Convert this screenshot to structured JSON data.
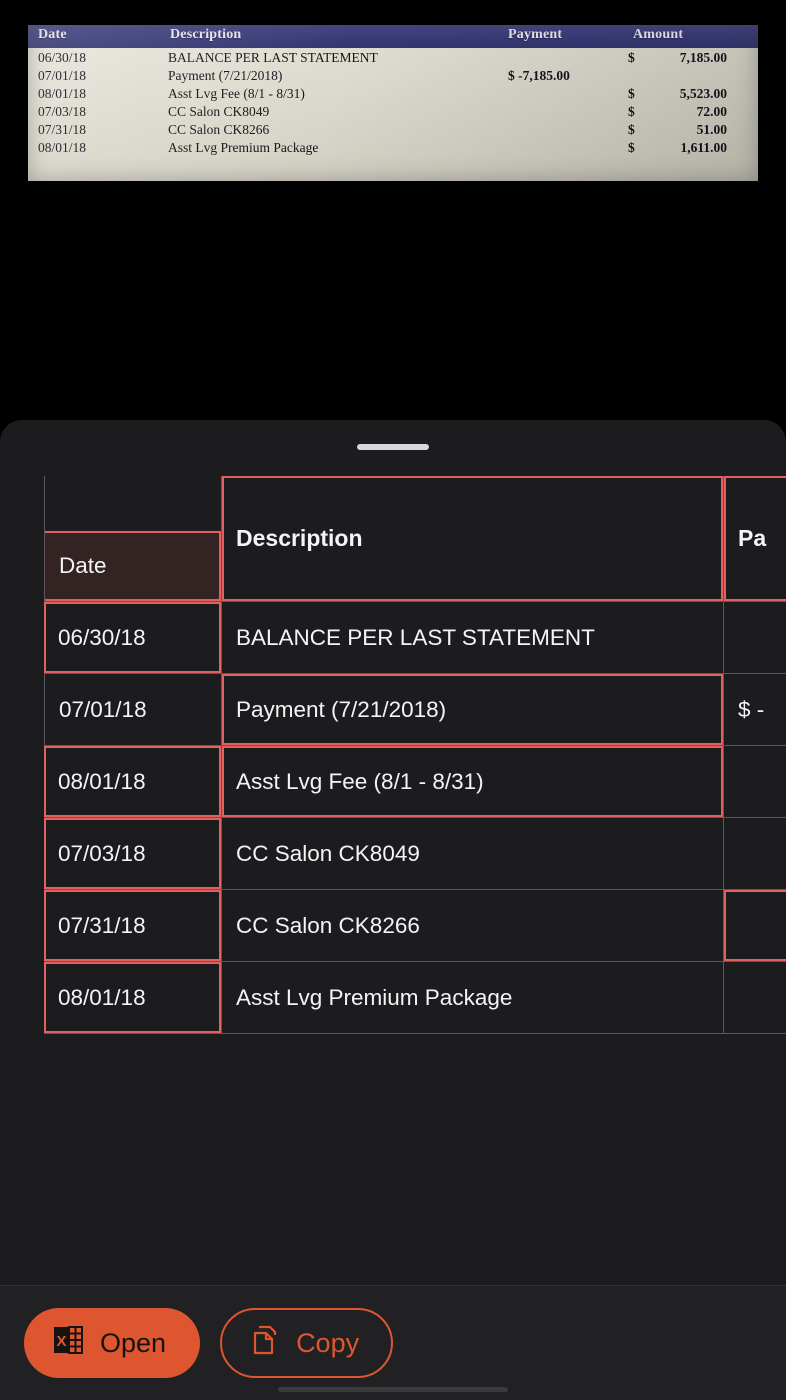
{
  "receipt_photo": {
    "columns": [
      "Date",
      "Description",
      "Payment",
      "Amount"
    ],
    "rows": [
      {
        "date": "06/30/18",
        "description": "BALANCE PER LAST STATEMENT",
        "payment": "",
        "currency": "$",
        "amount": "7,185.00"
      },
      {
        "date": "07/01/18",
        "description": "Payment (7/21/2018)",
        "payment": "$ -7,185.00",
        "currency": "",
        "amount": ""
      },
      {
        "date": "08/01/18",
        "description": "Asst Lvg Fee (8/1 - 8/31)",
        "payment": "",
        "currency": "$",
        "amount": "5,523.00"
      },
      {
        "date": "07/03/18",
        "description": "CC Salon CK8049",
        "payment": "",
        "currency": "$",
        "amount": "72.00"
      },
      {
        "date": "07/31/18",
        "description": "CC Salon CK8266",
        "payment": "",
        "currency": "$",
        "amount": "51.00"
      },
      {
        "date": "08/01/18",
        "description": "Asst Lvg Premium Package",
        "payment": "",
        "currency": "$",
        "amount": "1,611.00"
      }
    ]
  },
  "sheet": {
    "grabber_icon": "drag-handle",
    "table": {
      "headers": {
        "date": "Date",
        "description": "Description",
        "payment": "Pa"
      },
      "rows": [
        {
          "date": "06/30/18",
          "description": "BALANCE PER LAST STATEMENT",
          "payment": ""
        },
        {
          "date": "07/01/18",
          "description": "Payment (7/21/2018)",
          "payment": "$ -"
        },
        {
          "date": "08/01/18",
          "description": "Asst Lvg Fee (8/1 - 8/31)",
          "payment": ""
        },
        {
          "date": "07/03/18",
          "description": "CC Salon CK8049",
          "payment": ""
        },
        {
          "date": "07/31/18",
          "description": "CC Salon CK8266",
          "payment": ""
        },
        {
          "date": "08/01/18",
          "description": "Asst Lvg Premium Package",
          "payment": ""
        }
      ]
    }
  },
  "toolbar": {
    "open_label": "Open",
    "open_icon": "excel-file-icon",
    "copy_label": "Copy",
    "copy_icon": "copy-pages-icon"
  },
  "colors": {
    "accent": "#dd5630",
    "selection_border": "#e2605e",
    "selection_fill": "#332322",
    "sheet_background": "#1c1c1e",
    "receipt_header": "#3a3c7d"
  }
}
